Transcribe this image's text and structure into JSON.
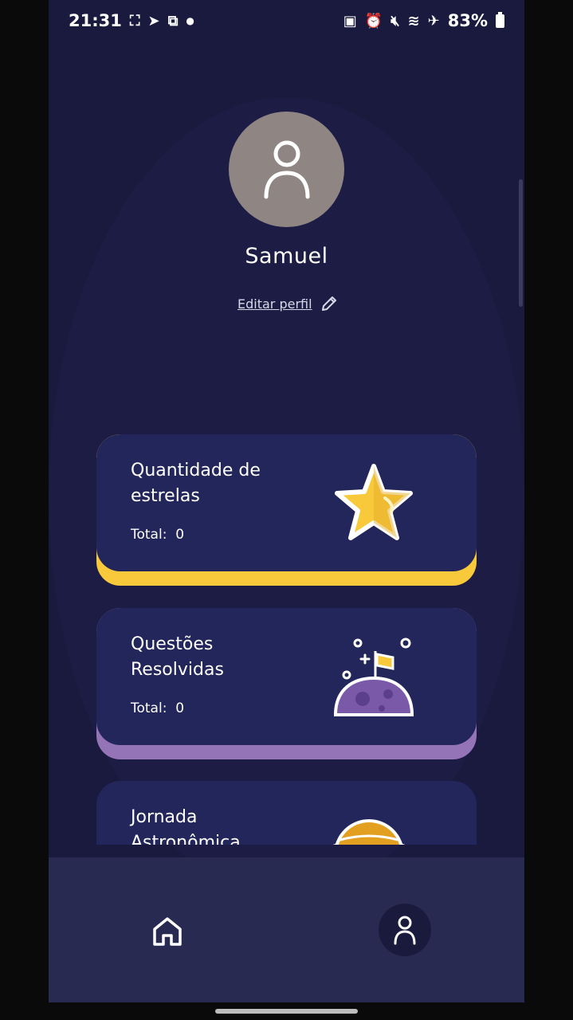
{
  "status_bar": {
    "time": "21:31",
    "battery_percent": "83%",
    "left_icons": [
      "screenshot-icon",
      "telegram-icon",
      "screen-record-icon",
      "dot-icon"
    ],
    "right_icons": [
      "battery-saver-icon",
      "alarm-icon",
      "mute-icon",
      "wifi-icon",
      "airplane-icon"
    ]
  },
  "profile": {
    "name": "Samuel",
    "edit_label": "Editar perfil"
  },
  "cards": [
    {
      "title": "Quantidade de estrelas",
      "total_label": "Total:",
      "total_value": "0",
      "icon": "star-icon",
      "accent": "#f8c93a"
    },
    {
      "title": "Questões Resolvidas",
      "total_label": "Total:",
      "total_value": "0",
      "icon": "planet-flag-icon",
      "accent": "#9474b6"
    },
    {
      "title": "Jornada Astronômica",
      "icon": "planet-icon"
    }
  ],
  "nav": {
    "items": [
      "home-icon",
      "profile-icon"
    ],
    "active": "profile"
  },
  "colors": {
    "background": "#1a1a3e",
    "card": "#23265a",
    "navbar": "#282a52"
  }
}
